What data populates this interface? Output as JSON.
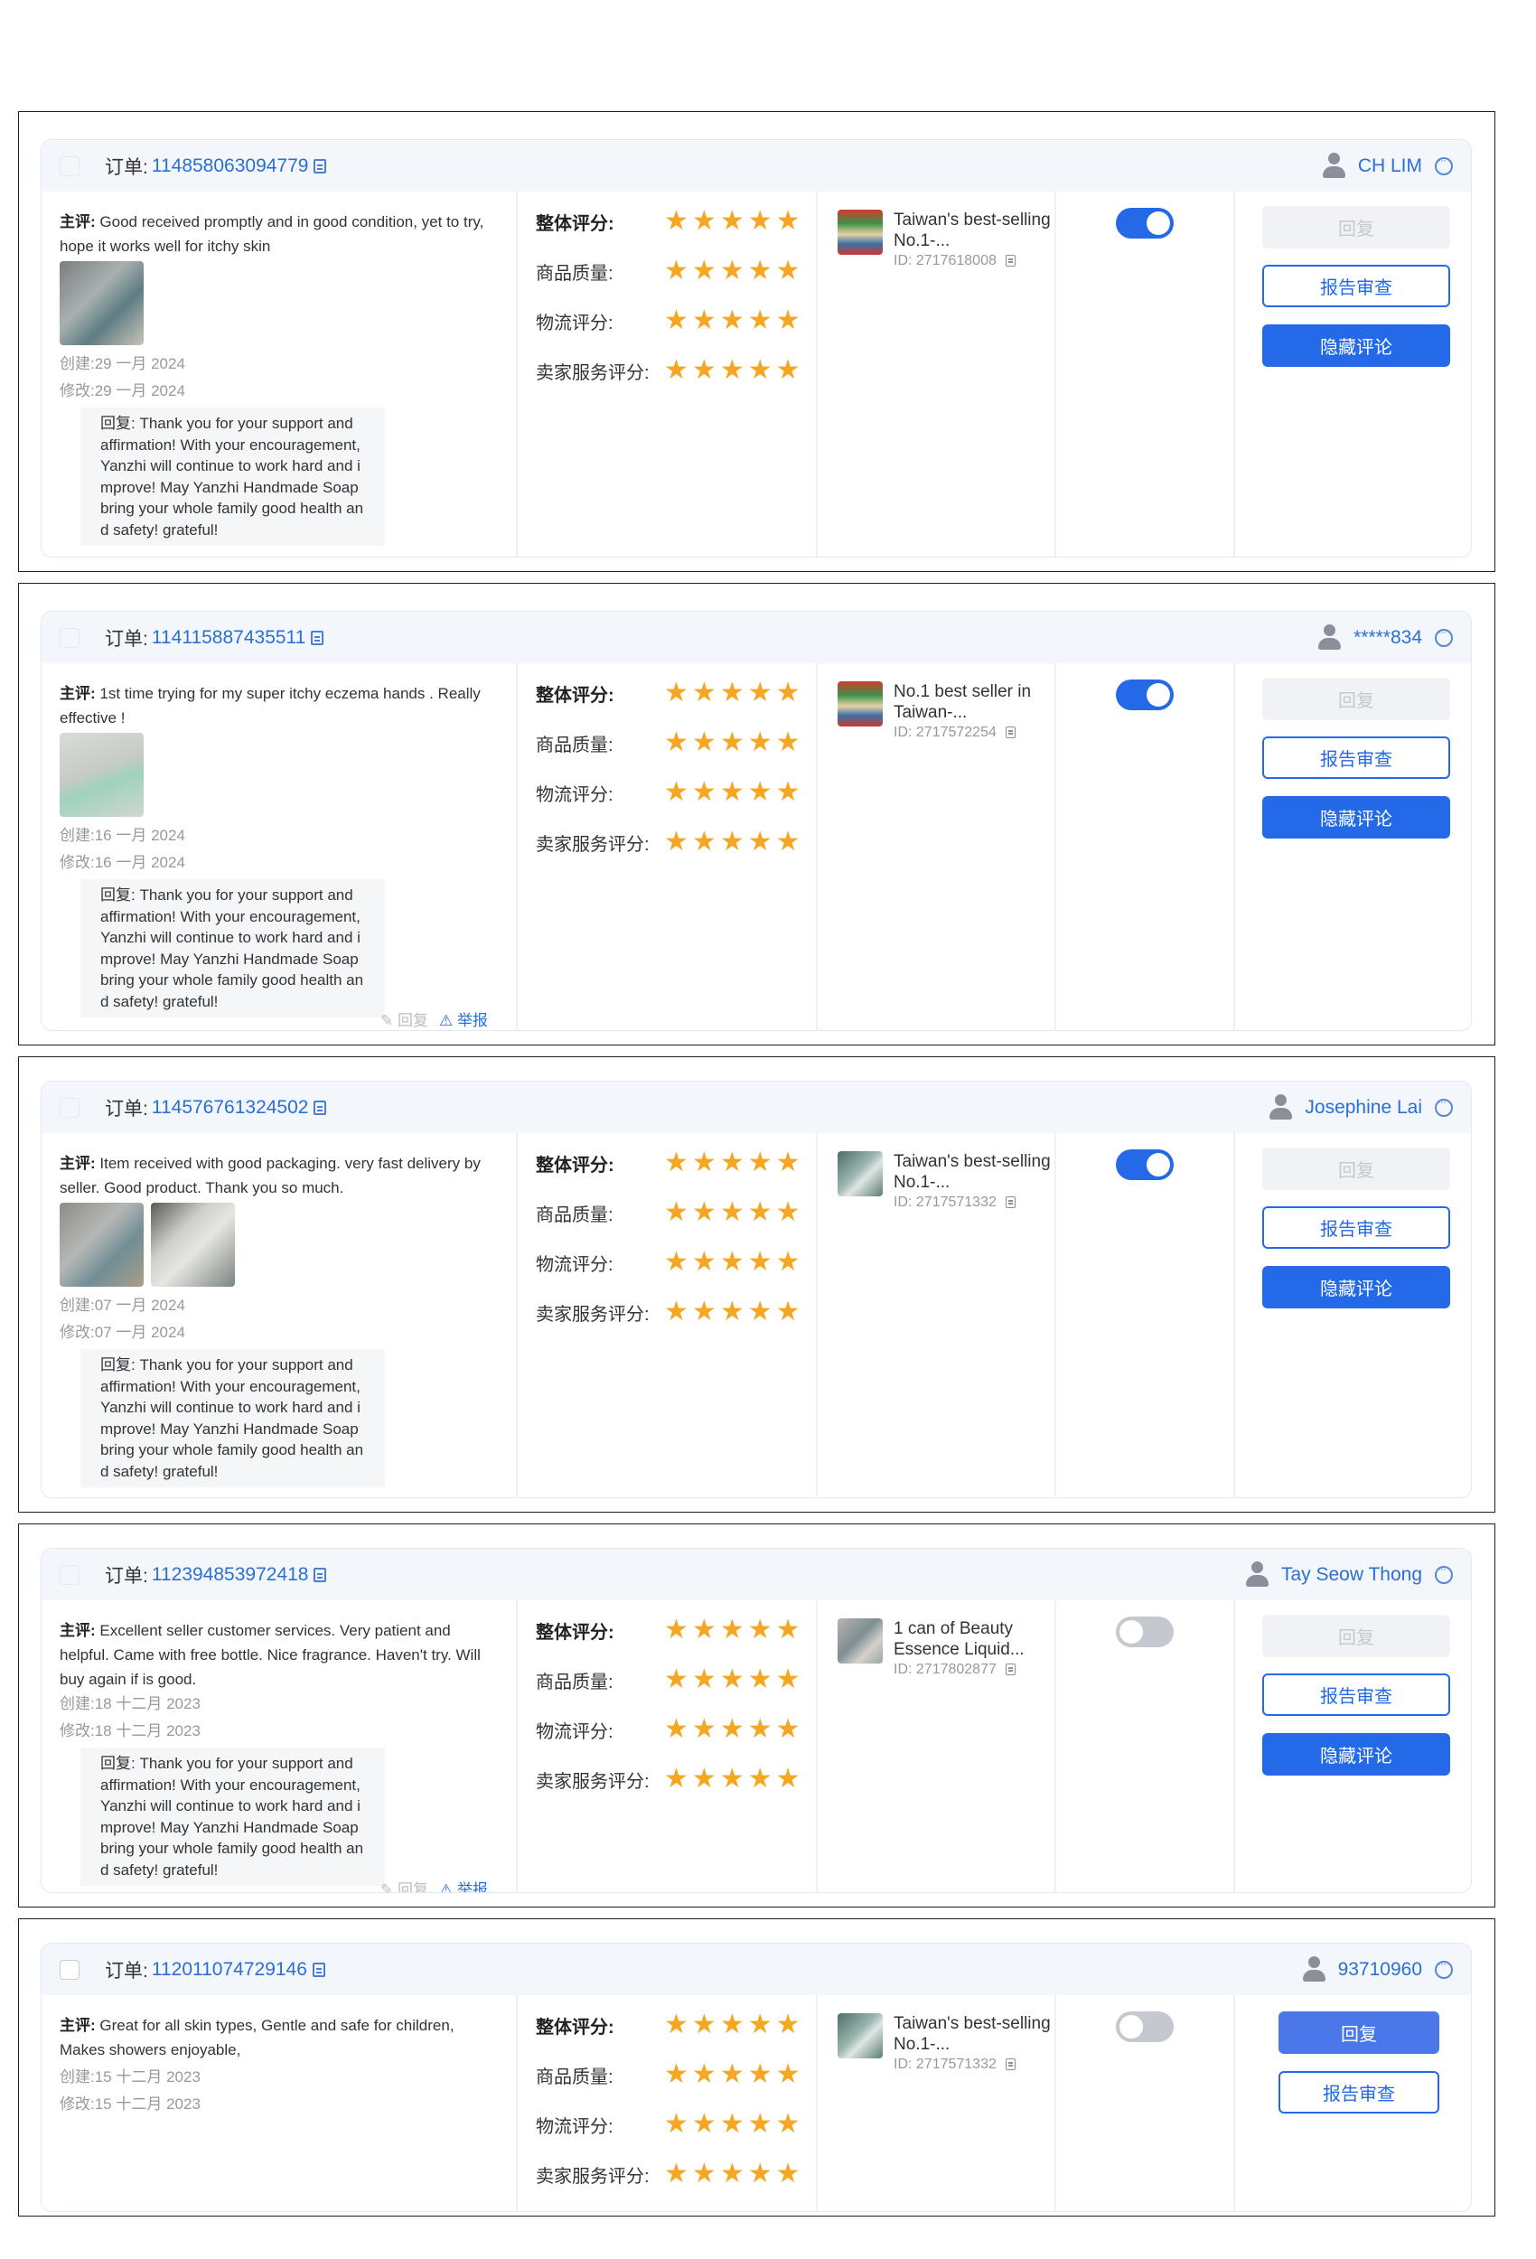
{
  "labels": {
    "order": "订单:",
    "main_review": "主评:",
    "overall": "整体评分:",
    "quality": "商品质量:",
    "logistics": "物流评分:",
    "seller_service": "卖家服务评分:",
    "reply_btn": "回复",
    "report_btn": "报告审查",
    "hide_btn": "隐藏评论",
    "reply_prefix": "回复:",
    "reply_action": "回复",
    "report_action": "举报",
    "star": "★"
  },
  "reviews": [
    {
      "order_no": "114858063094779",
      "user": "CH LIM",
      "comment": "Good received promptly and in good condition, yet to try, hope it works well for itchy skin",
      "created": "创建:29 一月 2024",
      "modified": "修改:29 一月 2024",
      "reply": "Thank you for your support and affirmation! With your encouragement, Yanzhi will continue to work hard and improve! May Yanzhi Handmade Soap bring your whole family good health and safety! grateful!",
      "ratings": {
        "overall": 5,
        "quality": 5,
        "logistics": 5,
        "seller_service": 5
      },
      "product_title": "Taiwan's best-selling No.1-...",
      "product_id": "ID: 2717618008",
      "toggle_on": true
    },
    {
      "order_no": "114115887435511",
      "user": "*****834",
      "comment": "1st time trying for my super itchy eczema hands . Really effective !",
      "created": "创建:16 一月 2024",
      "modified": "修改:16 一月 2024",
      "reply": "Thank you for your support and affirmation! With your encouragement, Yanzhi will continue to work hard and improve! May Yanzhi Handmade Soap bring your whole family good health and safety! grateful!",
      "ratings": {
        "overall": 5,
        "quality": 5,
        "logistics": 5,
        "seller_service": 5
      },
      "product_title": "No.1 best seller in Taiwan-...",
      "product_id": "ID: 2717572254",
      "toggle_on": true
    },
    {
      "order_no": "114576761324502",
      "user": "Josephine Lai",
      "comment": "Item received with good packaging. very fast delivery by seller. Good product. Thank you so much.",
      "created": "创建:07 一月 2024",
      "modified": "修改:07 一月 2024",
      "reply": "Thank you for your support and affirmation! With your encouragement, Yanzhi will continue to work hard and improve! May Yanzhi Handmade Soap bring your whole family good health and safety! grateful!",
      "ratings": {
        "overall": 5,
        "quality": 5,
        "logistics": 5,
        "seller_service": 5
      },
      "product_title": "Taiwan's best-selling No.1-...",
      "product_id": "ID: 2717571332",
      "toggle_on": true
    },
    {
      "order_no": "112394853972418",
      "user": "Tay Seow Thong",
      "comment": "Excellent seller customer services. Very patient and helpful. Came with free bottle. Nice fragrance. Haven't try. Will buy again if is good.",
      "created": "创建:18 十二月 2023",
      "modified": "修改:18 十二月 2023",
      "reply": "Thank you for your support and affirmation! With your encouragement, Yanzhi will continue to work hard and improve! May Yanzhi Handmade Soap bring your whole family good health and safety! grateful!",
      "ratings": {
        "overall": 5,
        "quality": 5,
        "logistics": 5,
        "seller_service": 5
      },
      "product_title": "1 can of Beauty Essence Liquid...",
      "product_id": "ID: 2717802877",
      "toggle_on": false
    },
    {
      "order_no": "112011074729146",
      "user": "93710960",
      "comment": "Great for all skin types, Gentle and safe for children, Makes showers enjoyable,",
      "created": "创建:15 十二月 2023",
      "modified": "修改:15 十二月 2023",
      "ratings": {
        "overall": 5,
        "quality": 5,
        "logistics": 5,
        "seller_service": 5
      },
      "product_title": "Taiwan's best-selling No.1-...",
      "product_id": "ID: 2717571332",
      "toggle_on": false
    }
  ],
  "colors": {
    "accent": "#2469e8",
    "star": "#f5a623",
    "link": "#2b6fd6"
  }
}
